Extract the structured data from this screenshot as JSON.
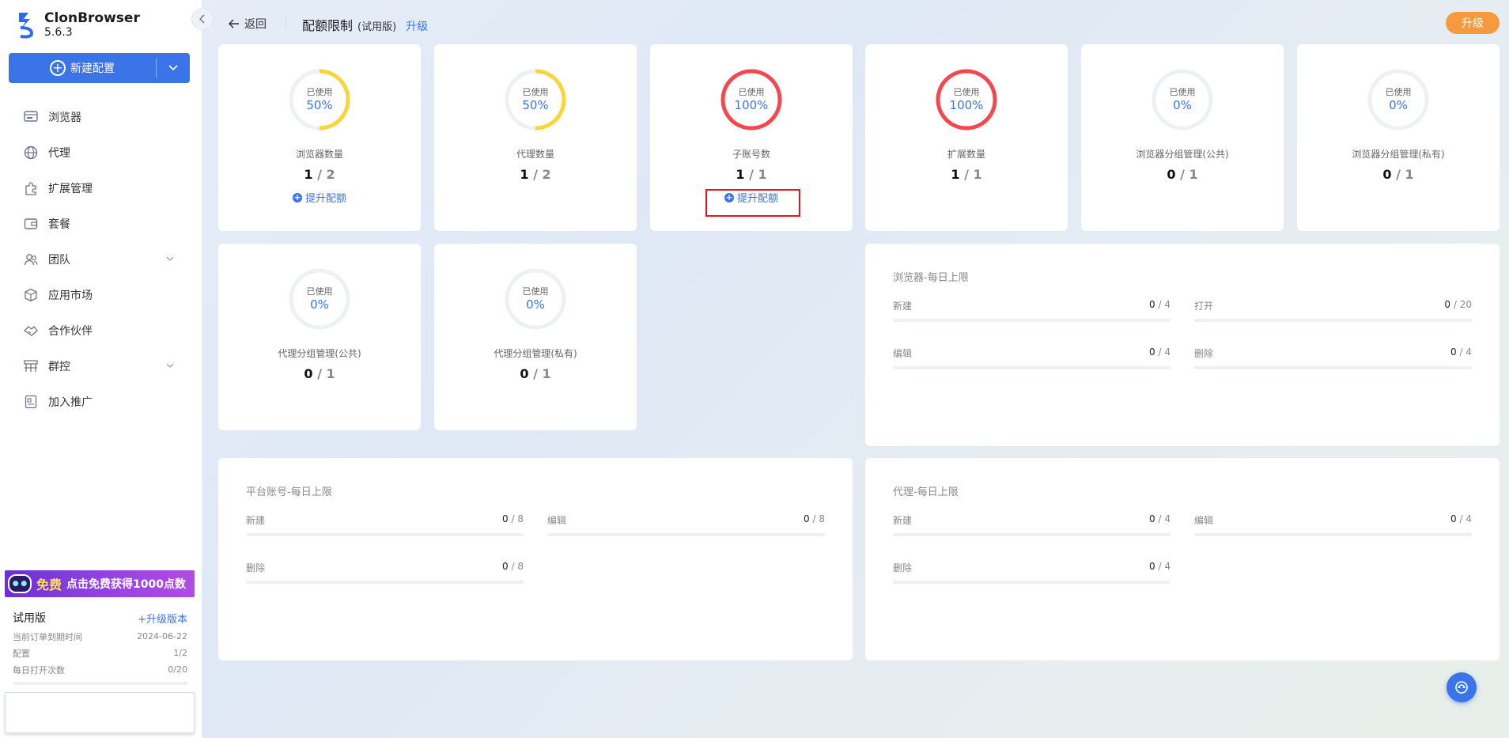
{
  "app": {
    "name": "ClonBrowser",
    "version": "5.6.3"
  },
  "sidebar": {
    "new_config_label": "新建配置",
    "items": [
      {
        "label": "浏览器",
        "icon": "browser-icon"
      },
      {
        "label": "代理",
        "icon": "globe-icon"
      },
      {
        "label": "扩展管理",
        "icon": "puzzle-icon"
      },
      {
        "label": "套餐",
        "icon": "wallet-icon"
      },
      {
        "label": "团队",
        "icon": "team-icon"
      },
      {
        "label": "应用市场",
        "icon": "cube-icon"
      },
      {
        "label": "合作伙伴",
        "icon": "handshake-icon"
      },
      {
        "label": "群控",
        "icon": "group-control-icon"
      },
      {
        "label": "加入推广",
        "icon": "promotion-icon"
      }
    ],
    "promo": {
      "free": "免费",
      "text": "点击免费获得1000点数"
    },
    "plan": {
      "name": "试用版",
      "upgrade": "+升级版本",
      "rows": [
        {
          "label": "当前订单到期时间",
          "value": "2024-06-22"
        },
        {
          "label": "配置",
          "value": "1/2"
        },
        {
          "label": "每日打开次数",
          "value": "0/20"
        }
      ]
    }
  },
  "header": {
    "back": "返回",
    "title": "配额限制",
    "trial": "(试用版)",
    "upgrade_link": "升级",
    "upgrade_button": "升级"
  },
  "quotas": [
    {
      "label": "浏览器数量",
      "used": "1",
      "total": "/ 2",
      "percent_text": "50%",
      "percent": 50,
      "color": "#f8d63a",
      "used_text": "已使用",
      "upgrade": "提升配额"
    },
    {
      "label": "代理数量",
      "used": "1",
      "total": "/ 2",
      "percent_text": "50%",
      "percent": 50,
      "color": "#f8d63a",
      "used_text": "已使用"
    },
    {
      "label": "子账号数",
      "used": "1",
      "total": "/ 1",
      "percent_text": "100%",
      "percent": 100,
      "color": "#f5474d",
      "used_text": "已使用",
      "upgrade": "提升配额"
    },
    {
      "label": "扩展数量",
      "used": "1",
      "total": "/ 1",
      "percent_text": "100%",
      "percent": 100,
      "color": "#f5474d",
      "used_text": "已使用"
    },
    {
      "label": "浏览器分组管理(公共)",
      "used": "0",
      "total": "/ 1",
      "percent_text": "0%",
      "percent": 0,
      "color": "#f8d63a",
      "used_text": "已使用"
    },
    {
      "label": "浏览器分组管理(私有)",
      "used": "0",
      "total": "/ 1",
      "percent_text": "0%",
      "percent": 0,
      "color": "#f8d63a",
      "used_text": "已使用"
    },
    {
      "label": "代理分组管理(公共)",
      "used": "0",
      "total": "/ 1",
      "percent_text": "0%",
      "percent": 0,
      "color": "#f8d63a",
      "used_text": "已使用"
    },
    {
      "label": "代理分组管理(私有)",
      "used": "0",
      "total": "/ 1",
      "percent_text": "0%",
      "percent": 0,
      "color": "#f8d63a",
      "used_text": "已使用"
    }
  ],
  "limits": {
    "browser": {
      "title": "浏览器-每日上限",
      "items": [
        {
          "label": "新建",
          "used": "0",
          "total": " / 4"
        },
        {
          "label": "打开",
          "used": "0",
          "total": " / 20"
        },
        {
          "label": "编辑",
          "used": "0",
          "total": " / 4"
        },
        {
          "label": "删除",
          "used": "0",
          "total": " / 4"
        }
      ]
    },
    "platform": {
      "title": "平台账号-每日上限",
      "items": [
        {
          "label": "新建",
          "used": "0",
          "total": " / 8"
        },
        {
          "label": "编辑",
          "used": "0",
          "total": " / 8"
        },
        {
          "label": "删除",
          "used": "0",
          "total": " / 8"
        }
      ]
    },
    "proxy": {
      "title": "代理-每日上限",
      "items": [
        {
          "label": "新建",
          "used": "0",
          "total": " / 4"
        },
        {
          "label": "编辑",
          "used": "0",
          "total": " / 4"
        },
        {
          "label": "删除",
          "used": "0",
          "total": " / 4"
        }
      ]
    }
  }
}
